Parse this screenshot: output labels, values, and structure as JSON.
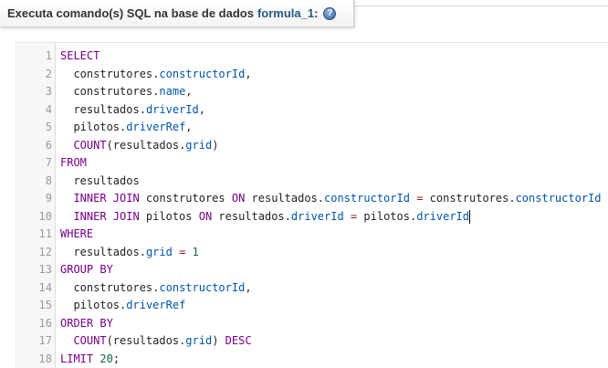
{
  "header": {
    "prefix": "Executa comando(s) SQL na base de dados",
    "database": "formula_1",
    "suffix": ":",
    "help_icon": "help-icon",
    "help_glyph": "?"
  },
  "editor": {
    "line_numbers": [
      "1",
      "2",
      "3",
      "4",
      "5",
      "6",
      "7",
      "8",
      "9",
      "10",
      "11",
      "12",
      "13",
      "14",
      "15",
      "16",
      "17",
      "18"
    ],
    "lines": [
      [
        {
          "t": "SELECT",
          "c": "kw"
        }
      ],
      [
        {
          "t": "  construtores",
          "c": "tbl"
        },
        {
          "t": ".",
          "c": "tbl"
        },
        {
          "t": "constructorId",
          "c": "fld"
        },
        {
          "t": ",",
          "c": "tbl"
        }
      ],
      [
        {
          "t": "  construtores",
          "c": "tbl"
        },
        {
          "t": ".",
          "c": "tbl"
        },
        {
          "t": "name",
          "c": "fld"
        },
        {
          "t": ",",
          "c": "tbl"
        }
      ],
      [
        {
          "t": "  resultados",
          "c": "tbl"
        },
        {
          "t": ".",
          "c": "tbl"
        },
        {
          "t": "driverId",
          "c": "fld"
        },
        {
          "t": ",",
          "c": "tbl"
        }
      ],
      [
        {
          "t": "  pilotos",
          "c": "tbl"
        },
        {
          "t": ".",
          "c": "tbl"
        },
        {
          "t": "driverRef",
          "c": "fld"
        },
        {
          "t": ",",
          "c": "tbl"
        }
      ],
      [
        {
          "t": "  COUNT",
          "c": "fn"
        },
        {
          "t": "(resultados",
          "c": "tbl"
        },
        {
          "t": ".",
          "c": "tbl"
        },
        {
          "t": "grid",
          "c": "fld"
        },
        {
          "t": ")",
          "c": "tbl"
        }
      ],
      [
        {
          "t": "FROM",
          "c": "kw"
        }
      ],
      [
        {
          "t": "  resultados",
          "c": "tbl"
        }
      ],
      [
        {
          "t": "  INNER JOIN",
          "c": "kw"
        },
        {
          "t": " construtores ",
          "c": "tbl"
        },
        {
          "t": "ON",
          "c": "kw"
        },
        {
          "t": " resultados",
          "c": "tbl"
        },
        {
          "t": ".",
          "c": "tbl"
        },
        {
          "t": "constructorId",
          "c": "fld"
        },
        {
          "t": " ",
          "c": "tbl"
        },
        {
          "t": "=",
          "c": "op"
        },
        {
          "t": " construtores",
          "c": "tbl"
        },
        {
          "t": ".",
          "c": "tbl"
        },
        {
          "t": "constructorId",
          "c": "fld"
        }
      ],
      [
        {
          "t": "  INNER JOIN",
          "c": "kw"
        },
        {
          "t": " pilotos ",
          "c": "tbl"
        },
        {
          "t": "ON",
          "c": "kw"
        },
        {
          "t": " resultados",
          "c": "tbl"
        },
        {
          "t": ".",
          "c": "tbl"
        },
        {
          "t": "driverId",
          "c": "fld"
        },
        {
          "t": " ",
          "c": "tbl"
        },
        {
          "t": "=",
          "c": "op"
        },
        {
          "t": " pilotos",
          "c": "tbl"
        },
        {
          "t": ".",
          "c": "tbl"
        },
        {
          "t": "driverId",
          "c": "fld"
        }
      ],
      [
        {
          "t": "WHERE",
          "c": "kw"
        }
      ],
      [
        {
          "t": "  resultados",
          "c": "tbl"
        },
        {
          "t": ".",
          "c": "tbl"
        },
        {
          "t": "grid",
          "c": "fld"
        },
        {
          "t": " ",
          "c": "tbl"
        },
        {
          "t": "=",
          "c": "op"
        },
        {
          "t": " ",
          "c": "tbl"
        },
        {
          "t": "1",
          "c": "num"
        }
      ],
      [
        {
          "t": "GROUP BY",
          "c": "kw"
        }
      ],
      [
        {
          "t": "  construtores",
          "c": "tbl"
        },
        {
          "t": ".",
          "c": "tbl"
        },
        {
          "t": "constructorId",
          "c": "fld"
        },
        {
          "t": ",",
          "c": "tbl"
        }
      ],
      [
        {
          "t": "  pilotos",
          "c": "tbl"
        },
        {
          "t": ".",
          "c": "tbl"
        },
        {
          "t": "driverRef",
          "c": "fld"
        }
      ],
      [
        {
          "t": "ORDER BY",
          "c": "kw"
        }
      ],
      [
        {
          "t": "  COUNT",
          "c": "fn"
        },
        {
          "t": "(resultados",
          "c": "tbl"
        },
        {
          "t": ".",
          "c": "tbl"
        },
        {
          "t": "grid",
          "c": "fld"
        },
        {
          "t": ") ",
          "c": "tbl"
        },
        {
          "t": "DESC",
          "c": "kw"
        }
      ],
      [
        {
          "t": "LIMIT",
          "c": "kw"
        },
        {
          "t": " ",
          "c": "tbl"
        },
        {
          "t": "20",
          "c": "num"
        },
        {
          "t": ";",
          "c": "tbl"
        }
      ]
    ],
    "cursor_line": 10
  },
  "colors": {
    "keyword": "#770088",
    "field": "#0055aa",
    "number": "#116644",
    "operator": "#981a1a",
    "db_link": "#235a81"
  }
}
